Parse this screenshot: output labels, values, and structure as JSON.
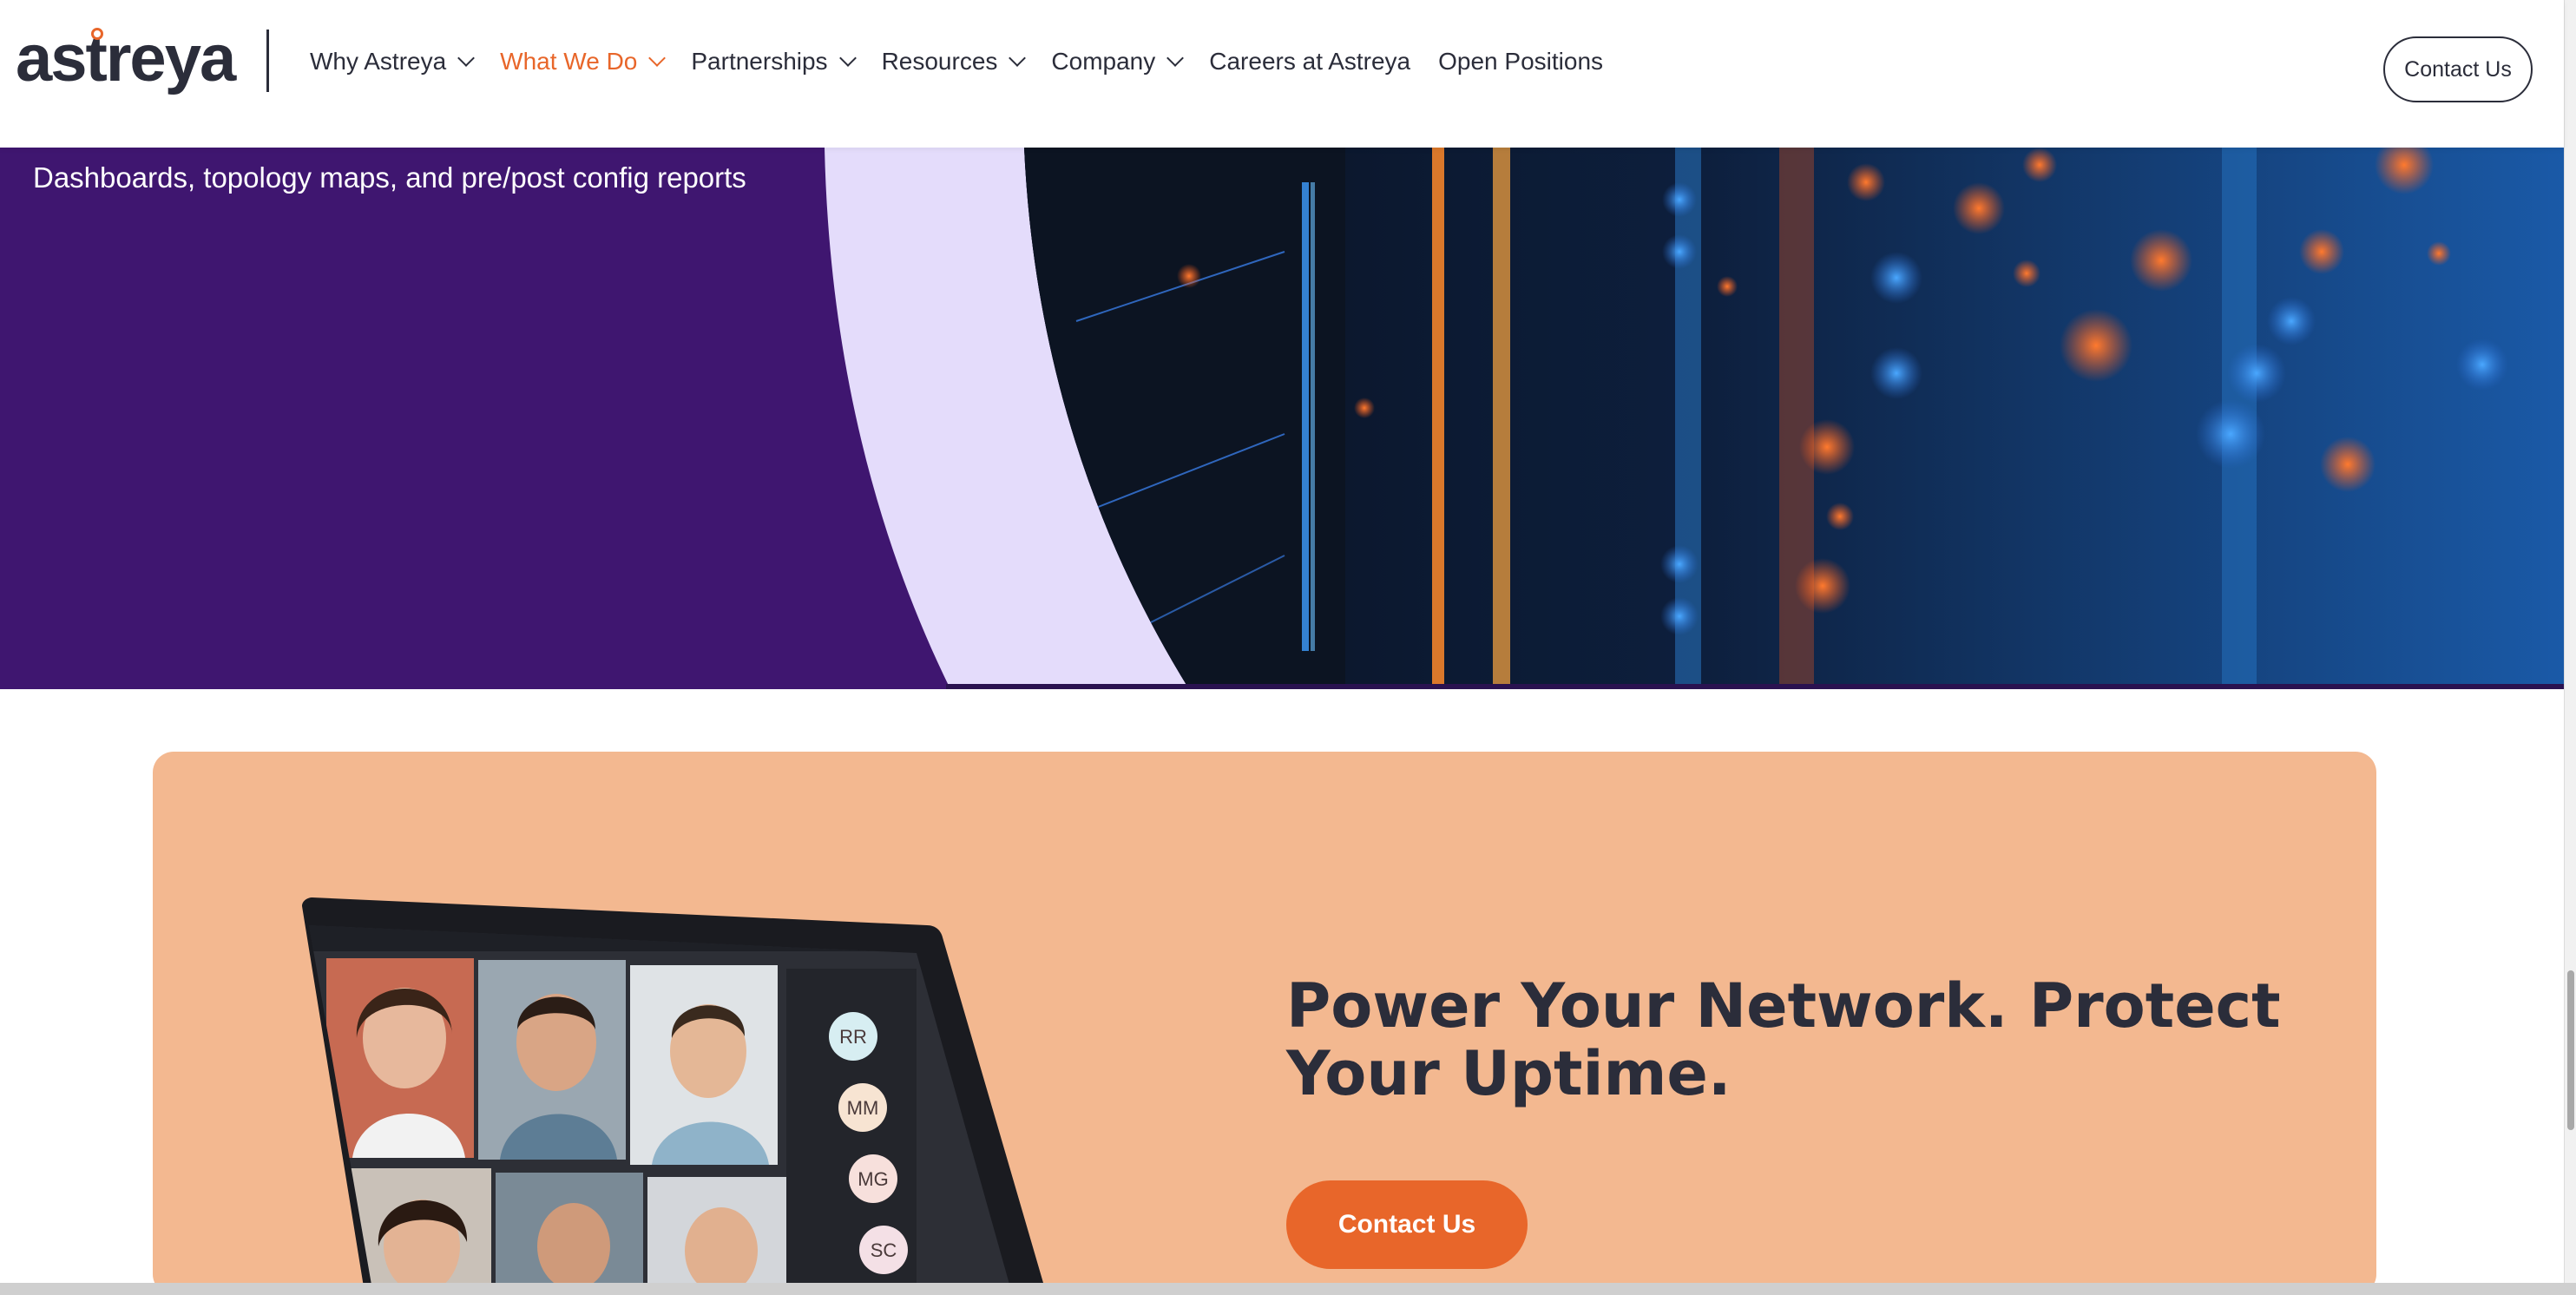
{
  "brand": {
    "logo_text": "astreya",
    "accent": "#e8662a",
    "purple": "#3f1670",
    "card_peach": "#f3b890"
  },
  "nav": {
    "items": [
      {
        "label": "Why Astreya",
        "dropdown": true,
        "active": false
      },
      {
        "label": "What We Do",
        "dropdown": true,
        "active": true
      },
      {
        "label": "Partnerships",
        "dropdown": true,
        "active": false
      },
      {
        "label": "Resources",
        "dropdown": true,
        "active": false
      },
      {
        "label": "Company",
        "dropdown": true,
        "active": false
      },
      {
        "label": "Careers at Astreya",
        "dropdown": false,
        "active": false
      },
      {
        "label": "Open Positions",
        "dropdown": false,
        "active": false
      }
    ],
    "contact_button": "Contact Us"
  },
  "hero": {
    "bullet_text": "Dashboards, topology maps, and pre/post config reports",
    "image": "server-rack-bokeh-photo"
  },
  "cta": {
    "title": "Power Your Network. Protect Your Uptime.",
    "button_label": "Contact Us",
    "image": "laptop-video-call",
    "participants": [
      "RR",
      "MM",
      "MG",
      "SC"
    ]
  }
}
